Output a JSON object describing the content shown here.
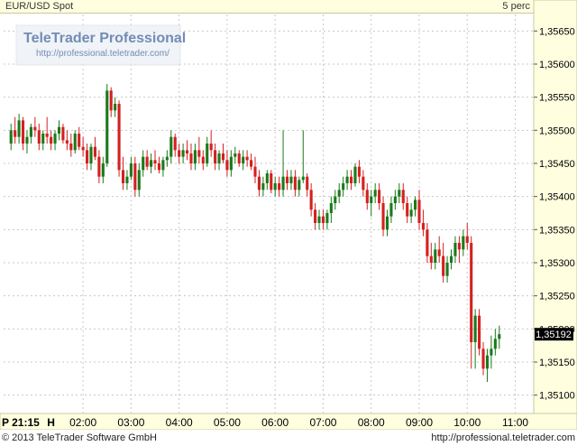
{
  "header": {
    "symbol": "EUR/USD Spot",
    "period": "5 perc"
  },
  "logo": {
    "title": "TeleTrader Professional",
    "url": "http://professional.teletrader.com/"
  },
  "footer": {
    "copyright": "© 2013 TeleTrader Software GmbH",
    "url": "http://professional.teletrader.com"
  },
  "last_price_label": "1,35192",
  "colors": {
    "up": "#1a7a1a",
    "down": "#d42020",
    "grid": "#c8c8c8",
    "axis_bg": "#ffffe0"
  },
  "chart_data": {
    "type": "candlestick",
    "title": "EUR/USD Spot",
    "interval": "5 perc",
    "ylim": [
      1.35075,
      1.35675
    ],
    "y_ticks": [
      "1,35650",
      "1,35600",
      "1,35550",
      "1,35500",
      "1,35450",
      "1,35400",
      "1,35350",
      "1,35300",
      "1,35250",
      "1,35200",
      "1,35150",
      "1,35100"
    ],
    "y_tick_values": [
      1.3565,
      1.356,
      1.3555,
      1.355,
      1.3545,
      1.354,
      1.3535,
      1.353,
      1.3525,
      1.352,
      1.3515,
      1.351
    ],
    "x_labels": [
      "P 21:15",
      "H",
      "02:00",
      "03:00",
      "04:00",
      "05:00",
      "06:00",
      "07:00",
      "08:00",
      "09:00",
      "10:00",
      "11:00"
    ],
    "x_label_index": [
      0,
      10,
      18,
      30,
      42,
      54,
      66,
      78,
      90,
      102,
      114,
      126
    ],
    "last_price": 1.35192,
    "grid": true,
    "candles": [
      [
        1.3548,
        1.3551,
        1.3547,
        1.355
      ],
      [
        1.355,
        1.3552,
        1.3548,
        1.3549
      ],
      [
        1.3549,
        1.35525,
        1.3548,
        1.35515
      ],
      [
        1.35515,
        1.3552,
        1.3547,
        1.3548
      ],
      [
        1.3548,
        1.355,
        1.35465,
        1.3549
      ],
      [
        1.3549,
        1.3551,
        1.3548,
        1.35505
      ],
      [
        1.35505,
        1.3552,
        1.3549,
        1.355
      ],
      [
        1.355,
        1.3551,
        1.3547,
        1.3548
      ],
      [
        1.3548,
        1.355,
        1.3547,
        1.35495
      ],
      [
        1.35495,
        1.3552,
        1.3548,
        1.3549
      ],
      [
        1.3549,
        1.355,
        1.3547,
        1.3548
      ],
      [
        1.3548,
        1.355,
        1.3547,
        1.35495
      ],
      [
        1.35495,
        1.35515,
        1.35485,
        1.35505
      ],
      [
        1.35505,
        1.3551,
        1.3548,
        1.35485
      ],
      [
        1.35485,
        1.355,
        1.3547,
        1.3548
      ],
      [
        1.3548,
        1.35495,
        1.3546,
        1.3547
      ],
      [
        1.3547,
        1.355,
        1.35465,
        1.35495
      ],
      [
        1.35495,
        1.35505,
        1.3547,
        1.35475
      ],
      [
        1.35475,
        1.3549,
        1.3546,
        1.3547
      ],
      [
        1.3547,
        1.3548,
        1.3544,
        1.3545
      ],
      [
        1.3545,
        1.3548,
        1.3544,
        1.35475
      ],
      [
        1.35475,
        1.3549,
        1.35455,
        1.3546
      ],
      [
        1.3546,
        1.3547,
        1.3542,
        1.3543
      ],
      [
        1.3543,
        1.3546,
        1.3542,
        1.3545
      ],
      [
        1.3545,
        1.3557,
        1.35445,
        1.3556
      ],
      [
        1.3556,
        1.35565,
        1.3552,
        1.3553
      ],
      [
        1.3553,
        1.3555,
        1.3552,
        1.3554
      ],
      [
        1.3554,
        1.35545,
        1.3543,
        1.3544
      ],
      [
        1.3544,
        1.3546,
        1.3541,
        1.3542
      ],
      [
        1.3542,
        1.3544,
        1.3541,
        1.3543
      ],
      [
        1.3543,
        1.3546,
        1.35425,
        1.3545
      ],
      [
        1.3545,
        1.3546,
        1.354,
        1.3541
      ],
      [
        1.3541,
        1.3545,
        1.354,
        1.3544
      ],
      [
        1.3544,
        1.3547,
        1.3543,
        1.3546
      ],
      [
        1.3546,
        1.3547,
        1.3544,
        1.35445
      ],
      [
        1.35445,
        1.35465,
        1.35435,
        1.35455
      ],
      [
        1.35455,
        1.3547,
        1.3544,
        1.3545
      ],
      [
        1.3545,
        1.3546,
        1.35435,
        1.3544
      ],
      [
        1.3544,
        1.3546,
        1.3543,
        1.35455
      ],
      [
        1.35455,
        1.3547,
        1.35445,
        1.3546
      ],
      [
        1.3546,
        1.355,
        1.3545,
        1.3549
      ],
      [
        1.3549,
        1.35495,
        1.3546,
        1.3547
      ],
      [
        1.3547,
        1.3548,
        1.3545,
        1.3546
      ],
      [
        1.3546,
        1.3548,
        1.3545,
        1.3547
      ],
      [
        1.3547,
        1.35485,
        1.35455,
        1.35465
      ],
      [
        1.35465,
        1.3548,
        1.3544,
        1.3545
      ],
      [
        1.3545,
        1.3548,
        1.3544,
        1.3547
      ],
      [
        1.3547,
        1.3549,
        1.3545,
        1.3546
      ],
      [
        1.3546,
        1.3547,
        1.3544,
        1.3545
      ],
      [
        1.3545,
        1.3549,
        1.35445,
        1.3548
      ],
      [
        1.3548,
        1.355,
        1.3546,
        1.3547
      ],
      [
        1.3547,
        1.3548,
        1.3544,
        1.3545
      ],
      [
        1.3545,
        1.3547,
        1.3544,
        1.35465
      ],
      [
        1.35465,
        1.3548,
        1.3545,
        1.35455
      ],
      [
        1.35455,
        1.3547,
        1.3543,
        1.3544
      ],
      [
        1.3544,
        1.3547,
        1.3543,
        1.3546
      ],
      [
        1.3546,
        1.35475,
        1.3545,
        1.35465
      ],
      [
        1.35465,
        1.3547,
        1.35445,
        1.3545
      ],
      [
        1.3545,
        1.3547,
        1.3544,
        1.3546
      ],
      [
        1.3546,
        1.3547,
        1.35445,
        1.35455
      ],
      [
        1.35455,
        1.35465,
        1.3544,
        1.35445
      ],
      [
        1.35445,
        1.3546,
        1.3542,
        1.3543
      ],
      [
        1.3543,
        1.3544,
        1.354,
        1.3541
      ],
      [
        1.3541,
        1.3543,
        1.354,
        1.3542
      ],
      [
        1.3542,
        1.3544,
        1.3541,
        1.35435
      ],
      [
        1.35435,
        1.3544,
        1.35405,
        1.3541
      ],
      [
        1.3541,
        1.3543,
        1.354,
        1.3542
      ],
      [
        1.3542,
        1.3543,
        1.354,
        1.3541
      ],
      [
        1.3541,
        1.355,
        1.354,
        1.3543
      ],
      [
        1.3543,
        1.3544,
        1.3541,
        1.3542
      ],
      [
        1.3542,
        1.3544,
        1.3541,
        1.3543
      ],
      [
        1.3543,
        1.3544,
        1.354,
        1.3541
      ],
      [
        1.3541,
        1.3543,
        1.354,
        1.35425
      ],
      [
        1.35425,
        1.355,
        1.3542,
        1.3543
      ],
      [
        1.3543,
        1.35435,
        1.354,
        1.3541
      ],
      [
        1.3541,
        1.3542,
        1.3537,
        1.3538
      ],
      [
        1.3538,
        1.3539,
        1.3535,
        1.3536
      ],
      [
        1.3536,
        1.3538,
        1.3535,
        1.3537
      ],
      [
        1.3537,
        1.3538,
        1.3535,
        1.3536
      ],
      [
        1.3536,
        1.3538,
        1.3535,
        1.35375
      ],
      [
        1.35375,
        1.354,
        1.3536,
        1.3539
      ],
      [
        1.3539,
        1.3541,
        1.3538,
        1.354
      ],
      [
        1.354,
        1.3542,
        1.3539,
        1.3541
      ],
      [
        1.3541,
        1.3543,
        1.354,
        1.3542
      ],
      [
        1.3542,
        1.3544,
        1.3541,
        1.3543
      ],
      [
        1.3543,
        1.3544,
        1.3541,
        1.3542
      ],
      [
        1.3542,
        1.3545,
        1.35415,
        1.35445
      ],
      [
        1.35445,
        1.35455,
        1.3542,
        1.3543
      ],
      [
        1.3543,
        1.3544,
        1.354,
        1.3541
      ],
      [
        1.3541,
        1.3542,
        1.3538,
        1.3539
      ],
      [
        1.3539,
        1.3541,
        1.3537,
        1.354
      ],
      [
        1.354,
        1.3542,
        1.3539,
        1.3541
      ],
      [
        1.3541,
        1.3542,
        1.3538,
        1.3539
      ],
      [
        1.3539,
        1.354,
        1.3534,
        1.3535
      ],
      [
        1.3535,
        1.3538,
        1.3534,
        1.3537
      ],
      [
        1.3537,
        1.354,
        1.3536,
        1.3539
      ],
      [
        1.3539,
        1.3541,
        1.3538,
        1.354
      ],
      [
        1.354,
        1.3542,
        1.3539,
        1.3541
      ],
      [
        1.3541,
        1.3542,
        1.3538,
        1.3539
      ],
      [
        1.3539,
        1.354,
        1.3536,
        1.3537
      ],
      [
        1.3537,
        1.3539,
        1.3536,
        1.3538
      ],
      [
        1.3538,
        1.354,
        1.3537,
        1.35395
      ],
      [
        1.35395,
        1.3541,
        1.3535,
        1.3536
      ],
      [
        1.3536,
        1.3538,
        1.3534,
        1.3535
      ],
      [
        1.3535,
        1.3536,
        1.353,
        1.3531
      ],
      [
        1.3531,
        1.3533,
        1.3529,
        1.353
      ],
      [
        1.353,
        1.3533,
        1.3529,
        1.3532
      ],
      [
        1.3532,
        1.3534,
        1.353,
        1.3531
      ],
      [
        1.3531,
        1.3533,
        1.3527,
        1.3528
      ],
      [
        1.3528,
        1.3531,
        1.3527,
        1.353
      ],
      [
        1.353,
        1.3532,
        1.3529,
        1.3531
      ],
      [
        1.3531,
        1.3534,
        1.353,
        1.3533
      ],
      [
        1.3533,
        1.3534,
        1.353,
        1.3532
      ],
      [
        1.3532,
        1.3535,
        1.3531,
        1.3534
      ],
      [
        1.3534,
        1.3536,
        1.3532,
        1.3533
      ],
      [
        1.3533,
        1.3534,
        1.3514,
        1.3518
      ],
      [
        1.3518,
        1.3523,
        1.3514,
        1.3522
      ],
      [
        1.3522,
        1.3523,
        1.3516,
        1.3517
      ],
      [
        1.3517,
        1.3518,
        1.3513,
        1.3514
      ],
      [
        1.3514,
        1.3517,
        1.3512,
        1.3516
      ],
      [
        1.3516,
        1.3519,
        1.3514,
        1.3517
      ],
      [
        1.3517,
        1.352,
        1.3516,
        1.35185
      ],
      [
        1.35185,
        1.35205,
        1.3517,
        1.35192
      ]
    ]
  }
}
